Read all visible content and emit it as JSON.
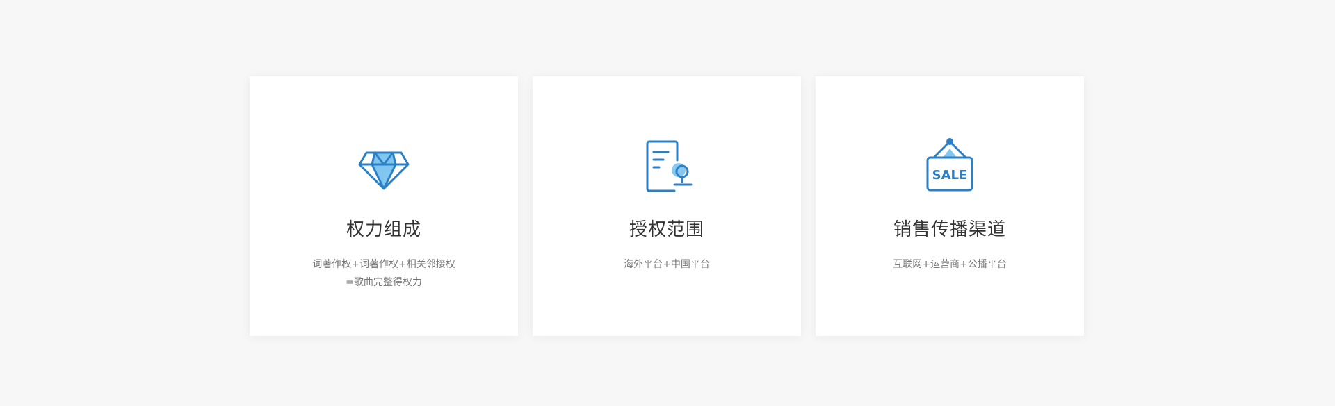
{
  "colors": {
    "background": "#f7f7f7",
    "card": "#ffffff",
    "icon_stroke": "#2b7fc4",
    "icon_fill": "#73bff0",
    "title": "#333333",
    "desc": "#777777"
  },
  "cards": [
    {
      "icon": "diamond-icon",
      "title": "权力组成",
      "desc_lines": [
        "词著作权+词著作权+相关邻接权",
        "=歌曲完整得权力"
      ]
    },
    {
      "icon": "certificate-stamp-icon",
      "title": "授权范围",
      "desc_lines": [
        "海外平台+中国平台"
      ]
    },
    {
      "icon": "sale-sign-icon",
      "title": "销售传播渠道",
      "desc_lines": [
        "互联网+运营商+公播平台"
      ],
      "icon_text": "SALE"
    }
  ]
}
